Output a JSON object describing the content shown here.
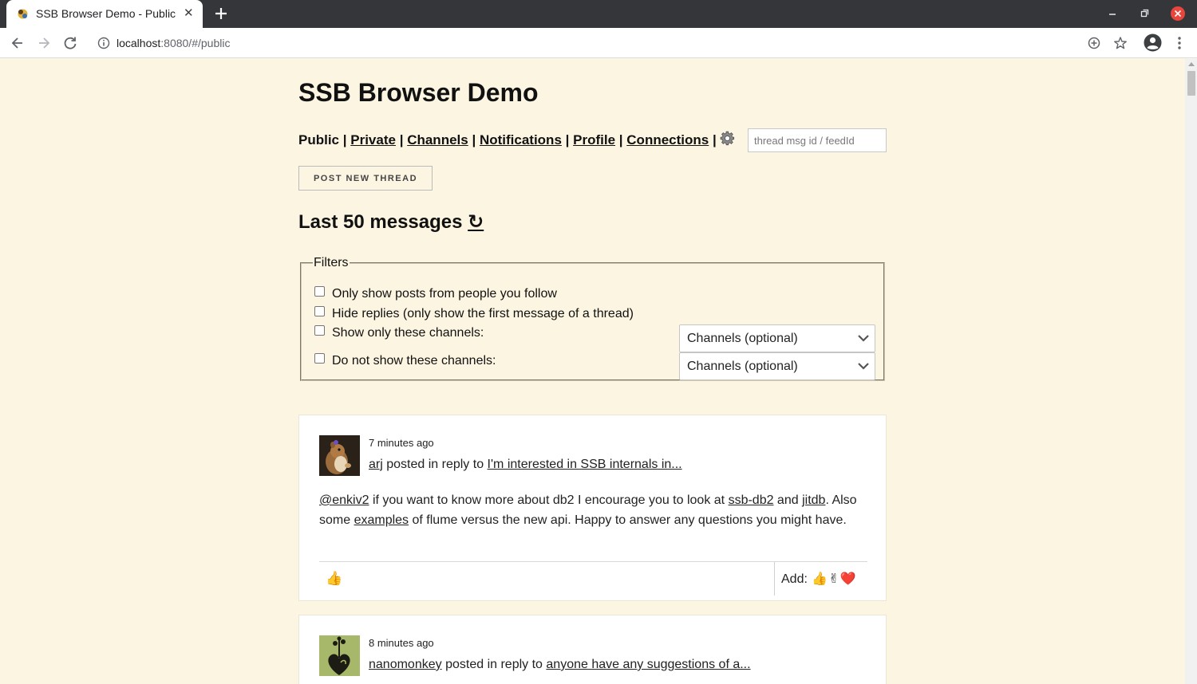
{
  "browser": {
    "tab_title": "SSB Browser Demo - Public",
    "url_host": "localhost",
    "url_rest": ":8080/#/public"
  },
  "page": {
    "title": "SSB Browser Demo",
    "nav": {
      "current": "Public",
      "links": [
        "Private",
        "Channels",
        "Notifications",
        "Profile",
        "Connections"
      ],
      "separator": "|"
    },
    "search_placeholder": "thread msg id / feedId",
    "post_button": "POST NEW THREAD",
    "heading": "Last 50 messages",
    "refresh_symbol": "↻",
    "filters": {
      "legend": "Filters",
      "options": [
        "Only show posts from people you follow",
        "Hide replies (only show the first message of a thread)",
        "Show only these channels:",
        "Do not show these channels:"
      ],
      "select_placeholder": "Channels (optional)"
    }
  },
  "posts": [
    {
      "timestamp": "7 minutes ago",
      "author": "arj",
      "action": "posted in reply to",
      "thread": "I'm interested in SSB internals in...",
      "body": {
        "mention": "@enkiv2",
        "t1": " if you want to know more about db2 I encourage you to look at ",
        "link1": "ssb-db2",
        "t2": " and ",
        "link2": "jitdb",
        "t3": ". Also some ",
        "link3": "examples",
        "t4": " of flume versus the new api. Happy to answer any questions you might have."
      },
      "reaction": "👍",
      "add_label": "Add:",
      "add_emojis": [
        "👍",
        "✌",
        "❤️"
      ]
    },
    {
      "timestamp": "8 minutes ago",
      "author": "nanomonkey",
      "action": "posted in reply to",
      "thread": "anyone have any suggestions of a..."
    }
  ],
  "icons": {
    "favicon": "ssb-hermies-icon",
    "gear": "gear-icon",
    "select": "chevron-down-icon"
  }
}
